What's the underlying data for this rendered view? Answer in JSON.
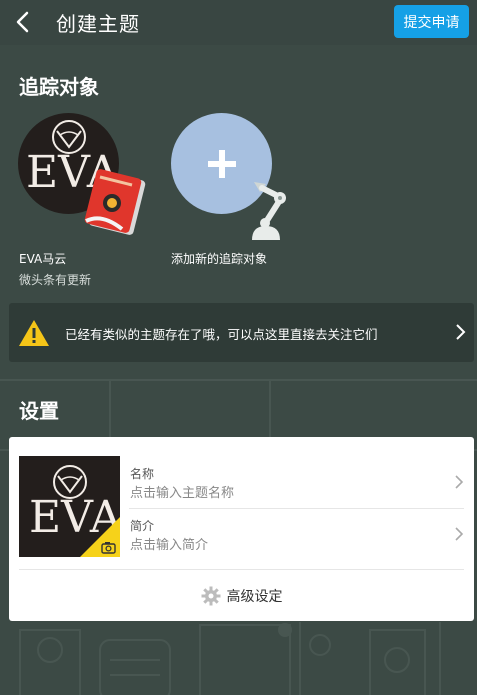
{
  "header": {
    "title": "创建主题",
    "submit_label": "提交申请"
  },
  "tracked": {
    "section_title": "追踪对象",
    "items": [
      {
        "name": "EVA马云",
        "subtitle": "微头条有更新",
        "logo_text": "EVA"
      }
    ],
    "add_label": "添加新的追踪对象"
  },
  "notice": {
    "text": "已经有类似的主题存在了哦，可以点这里直接去关注它们"
  },
  "settings": {
    "section_title": "设置",
    "logo_text": "EVA",
    "name_label": "名称",
    "name_placeholder": "点击输入主题名称",
    "intro_label": "简介",
    "intro_placeholder": "点击输入简介",
    "advanced_label": "高级设定"
  },
  "colors": {
    "background": "#3c4a45",
    "accent": "#15a0e6",
    "add_circle": "#a7c0e0",
    "warning": "#f5c518"
  }
}
